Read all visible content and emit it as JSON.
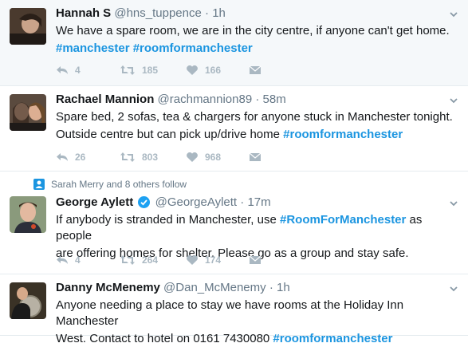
{
  "tweets": [
    {
      "name": "Hannah S",
      "handle": "@hns_tuppence",
      "dot": "·",
      "time": "1h",
      "text": "We have a spare room, we are in the city centre, if anyone can't get home.",
      "hashtags_line": "#manchester #roomformanchester",
      "replies": "4",
      "retweets": "185",
      "likes": "166"
    },
    {
      "name": "Rachael Mannion",
      "handle": "@rachmannion89",
      "dot": "·",
      "time": "58m",
      "text_line1": "Spare bed, 2 sofas, tea & chargers for anyone stuck in Manchester tonight.",
      "text_line2": "Outside centre but can pick up/drive home ",
      "hashtag": "#roomformanchester",
      "replies": "26",
      "retweets": "803",
      "likes": "968"
    },
    {
      "social_context": "Sarah Merry and 8 others follow",
      "name": "George Aylett",
      "handle": "@GeorgeAylett",
      "dot": "·",
      "time": "17m",
      "text_pre": "If anybody is stranded in Manchester, use ",
      "hashtag": "#RoomForManchester",
      "text_post": " as people",
      "text_line2": "are offering homes for shelter. Please go as a group and stay safe.",
      "replies": "4",
      "retweets": "264",
      "likes": "174"
    },
    {
      "name": "Danny McMenemy",
      "handle": "@Dan_McMenemy",
      "dot": "·",
      "time": "1h",
      "text_line1": "Anyone needing a place to stay we have rooms at the Holiday Inn Manchester",
      "text_line2": "West. Contact to hotel on 0161 7430080 ",
      "hashtag": "#roomformanchester"
    }
  ],
  "colors": {
    "accent": "#1b95e0",
    "icon_gray": "#aab8c2",
    "meta_gray": "#657786",
    "highlight_bg": "#f5f8fa"
  }
}
